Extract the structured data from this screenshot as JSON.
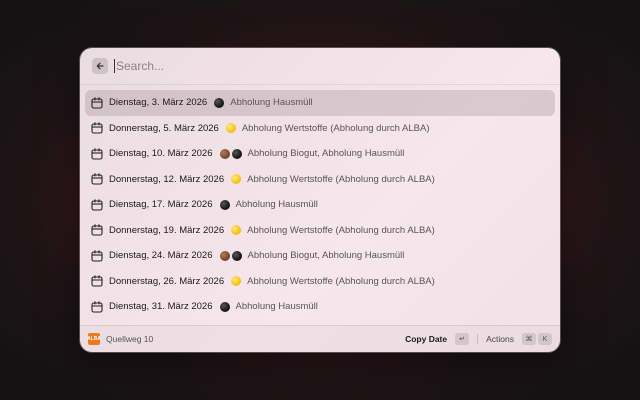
{
  "search": {
    "placeholder": "Search..."
  },
  "items": [
    {
      "date": "Dienstag, 3. März 2026",
      "dots": [
        "black"
      ],
      "label": "Abholung Hausmüll"
    },
    {
      "date": "Donnerstag, 5. März 2026",
      "dots": [
        "yellow"
      ],
      "label": "Abholung Wertstoffe (Abholung durch ALBA)"
    },
    {
      "date": "Dienstag, 10. März 2026",
      "dots": [
        "brown",
        "black"
      ],
      "label": "Abholung Biogut, Abholung Hausmüll"
    },
    {
      "date": "Donnerstag, 12. März 2026",
      "dots": [
        "yellow"
      ],
      "label": "Abholung Wertstoffe (Abholung durch ALBA)"
    },
    {
      "date": "Dienstag, 17. März 2026",
      "dots": [
        "black"
      ],
      "label": "Abholung Hausmüll"
    },
    {
      "date": "Donnerstag, 19. März 2026",
      "dots": [
        "yellow"
      ],
      "label": "Abholung Wertstoffe (Abholung durch ALBA)"
    },
    {
      "date": "Dienstag, 24. März 2026",
      "dots": [
        "brown",
        "black"
      ],
      "label": "Abholung Biogut, Abholung Hausmüll"
    },
    {
      "date": "Donnerstag, 26. März 2026",
      "dots": [
        "yellow"
      ],
      "label": "Abholung Wertstoffe (Abholung durch ALBA)"
    },
    {
      "date": "Dienstag, 31. März 2026",
      "dots": [
        "black"
      ],
      "label": "Abholung Hausmüll"
    }
  ],
  "footer": {
    "app_icon_text": "ALBA",
    "title": "Quellweg 10",
    "primary_action": "Copy Date",
    "primary_shortcut": "↵",
    "secondary_action": "Actions",
    "secondary_shortcut_mod": "⌘",
    "secondary_shortcut_key": "K"
  },
  "colors": {
    "accent_app": "#f07820",
    "dot_black": "#1a1a1a",
    "dot_brown": "#7a4a30",
    "dot_yellow": "#f5c518"
  },
  "icons": {
    "back": "arrow-left-icon",
    "row": "calendar-icon",
    "app": "alba-app-icon"
  }
}
